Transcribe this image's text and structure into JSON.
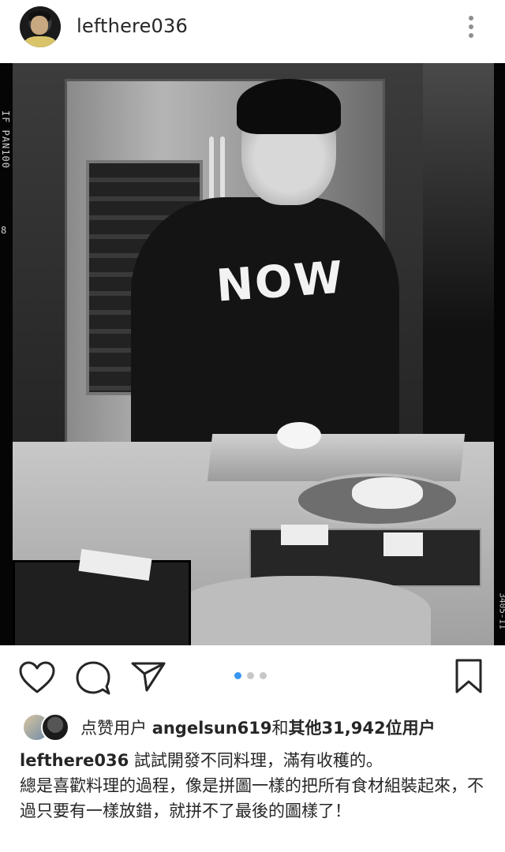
{
  "post": {
    "username": "lefthere036",
    "more_icon": "more-vertical-icon"
  },
  "photo": {
    "film_left_text": "IF PAN100",
    "film_left_number": "8",
    "film_right_text": "3405-11",
    "sweater_text": "NOW"
  },
  "actions": {
    "like_icon": "heart-icon",
    "comment_icon": "comment-icon",
    "share_icon": "send-icon",
    "save_icon": "bookmark-icon",
    "carousel_count": 3,
    "carousel_active_index": 0,
    "active_dot_color": "#3897f0"
  },
  "likes": {
    "prefix": "点赞用户 ",
    "first_user": "angelsun619",
    "connector": "和",
    "others": "其他31,942位用户"
  },
  "caption": {
    "username": "lefthere036",
    "text": " 試試開發不同料理，滿有收穫的。\n總是喜歡料理的過程，像是拼圖一樣的把所有食材組裝起來，不過只要有一樣放錯，就拼不了最後的圖樣了！"
  }
}
